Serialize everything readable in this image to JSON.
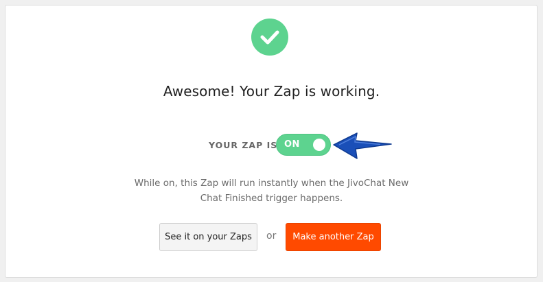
{
  "colors": {
    "success": "#5dd38f",
    "primary": "#ff4a00",
    "arrow": "#1a4fb8"
  },
  "header": {
    "icon": "check-icon",
    "title": "Awesome! Your Zap is working."
  },
  "status": {
    "label": "YOUR ZAP IS",
    "toggle_text": "ON",
    "toggle_on": true
  },
  "annotation": {
    "icon": "arrow-left-icon"
  },
  "description": {
    "line1": "While on, this Zap will run instantly when the JivoChat New",
    "line2": "Chat Finished trigger happens."
  },
  "actions": {
    "secondary_label": "See it on your Zaps",
    "separator": "or",
    "primary_label": "Make another Zap"
  }
}
